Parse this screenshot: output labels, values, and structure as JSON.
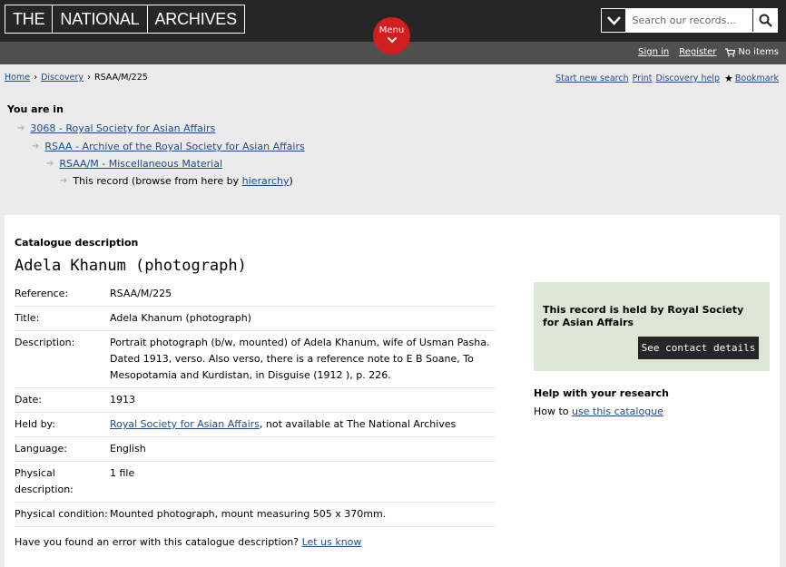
{
  "header": {
    "logo": [
      "THE",
      "NATIONAL",
      "ARCHIVES"
    ],
    "search_placeholder": "Search our records...",
    "menu_label": "Menu"
  },
  "account": {
    "sign_in": "Sign in",
    "register": "Register",
    "basket": "No items"
  },
  "breadcrumb": [
    "Home",
    "Discovery",
    "RSAA/M/225"
  ],
  "tools": [
    "Start new search",
    "Print",
    "Discovery help",
    "Bookmark"
  ],
  "hierarchy": {
    "heading": "You are in",
    "level1": "3068 - Royal Society for Asian Affairs",
    "level2": "RSAA - Archive of the Royal Society for Asian Affairs",
    "level3": "RSAA/M - Miscellaneous Material",
    "current_prefix": "This record (browse from here by ",
    "current_link": "hierarchy",
    "current_suffix": ")"
  },
  "record": {
    "section_heading": "Catalogue description",
    "title": "Adela Khanum (photograph)",
    "fields": [
      {
        "label": "Reference:",
        "value": "RSAA/M/225"
      },
      {
        "label": "Title:",
        "value": "Adela Khanum (photograph)"
      },
      {
        "label": "Description:",
        "value": "Portrait photograph (b/w, mounted) of Adela Khanum, wife of Usman Pasha. Dated 1913, verso. Also verso, there is a reference note to E B Soane, To Mesopotamia and Kurdistan, in Disguise (1912 ), p. 226."
      },
      {
        "label": "Date:",
        "value": "1913"
      },
      {
        "label": "Held by:",
        "link": "Royal Society for Asian Affairs",
        "value": ", not available at The National Archives"
      },
      {
        "label": "Language:",
        "value": "English"
      },
      {
        "label": "Physical description:",
        "value": "1 file"
      },
      {
        "label": "Physical condition:",
        "value": "Mounted photograph, mount measuring 505 x 370mm."
      }
    ],
    "error_text": "Have you found an error with this catalogue description?",
    "error_link": "Let us know"
  },
  "sidebar": {
    "held_text": "This record is held by Royal Society for Asian Affairs",
    "contact_button": "See contact details",
    "help_heading": "Help with your research",
    "help_prefix": "How to",
    "help_link": "use this catalogue"
  }
}
